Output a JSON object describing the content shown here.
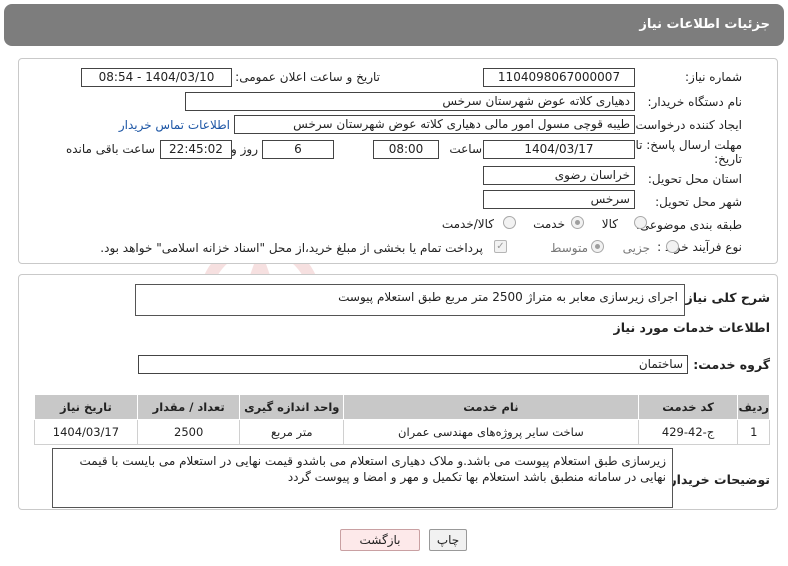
{
  "header": {
    "title": "جزئیات اطلاعات نیاز"
  },
  "form": {
    "need_number": {
      "label": "شماره نیاز:",
      "value": "1104098067000007"
    },
    "announce_datetime": {
      "label": "تاریخ و ساعت اعلان عمومی:",
      "value": "1404/03/10 - 08:54"
    },
    "buyer_org": {
      "label": "نام دستگاه خریدار:",
      "value": "دهیاری کلاته عوض شهرستان سرخس"
    },
    "requester": {
      "label": "ایجاد کننده درخواست:",
      "value": "طیبه قوچی مسول امور مالی دهیاری کلاته عوض شهرستان سرخس",
      "contact_link": "اطلاعات تماس خریدار"
    },
    "deadline": {
      "label_line1": "مهلت ارسال پاسخ: تا",
      "label_line2": "تاریخ:",
      "date": "1404/03/17",
      "time_label": "ساعت",
      "time": "08:00",
      "days": "6",
      "days_label": "روز و",
      "remaining": "22:45:02",
      "remaining_label": "ساعت باقی مانده"
    },
    "province": {
      "label": "استان محل تحویل:",
      "value": "خراسان رضوی"
    },
    "city": {
      "label": "شهر محل تحویل:",
      "value": "سرخس"
    },
    "category": {
      "label": "طبقه بندی موضوعی:",
      "options": [
        "کالا",
        "خدمت",
        "کالا/خدمت"
      ],
      "selected": "خدمت"
    },
    "purchase_type": {
      "label": "نوع فرآیند خرید :",
      "options": [
        "جزیی",
        "متوسط"
      ],
      "selected": "متوسط",
      "treasury_note": "پرداخت تمام یا بخشی از مبلغ خرید،از محل \"اسناد خزانه اسلامی\" خواهد بود."
    }
  },
  "summary": {
    "label": "شرح کلی نیاز:",
    "value": "اجرای زیرسازی معابر به متراژ 2500 متر مربع طبق استعلام پیوست"
  },
  "services": {
    "section_title": "اطلاعات خدمات مورد نیاز",
    "group_label": "گروه خدمت:",
    "group_value": "ساختمان",
    "columns": [
      "ردیف",
      "کد خدمت",
      "نام خدمت",
      "واحد اندازه گیری",
      "تعداد / مقدار",
      "تاریخ نیاز"
    ],
    "rows": [
      [
        "1",
        "ج-42-429",
        "ساخت سایر پروژه‌های مهندسی عمران",
        "متر مربع",
        "2500",
        "1404/03/17"
      ]
    ]
  },
  "buyer_notes": {
    "label": "توضیحات خریدار:",
    "value": "زیرسازی طبق استعلام  پیوست می باشد.و ملاک  دهیاری استعلام  می باشدو قیمت نهایی در استعلام می بایست با قیمت  نهایی در سامانه  منطبق باشد استعلام  بها  تکمیل  و مهر و امضا و پیوست  گردد"
  },
  "buttons": {
    "print": "چاپ",
    "back": "بازگشت"
  },
  "watermark": {
    "text": "AriaTender.neT"
  },
  "colors": {
    "header_bg": "#7d7d7d",
    "link": "#1d56a5",
    "table_header": "#c8c8c8",
    "back_button": "#fde9ea",
    "watermark": "#f4d6d6"
  }
}
